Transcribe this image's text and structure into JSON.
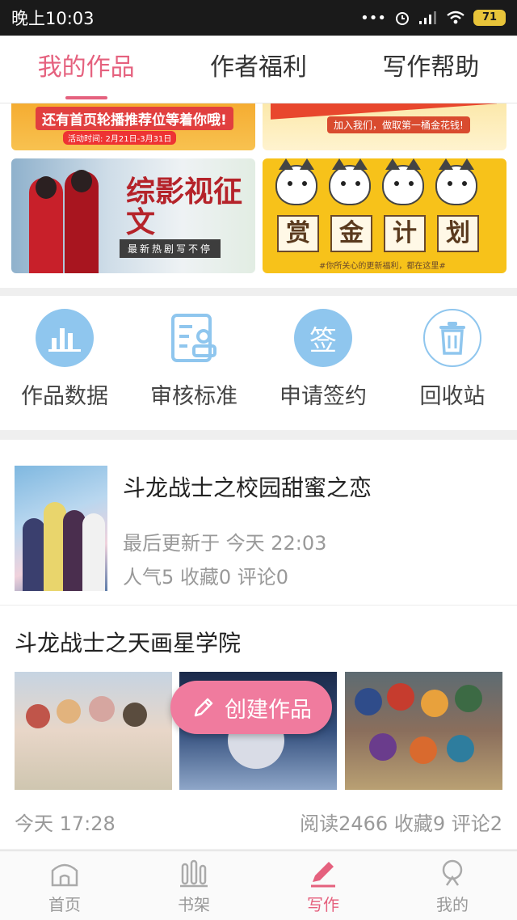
{
  "status_bar": {
    "time": "晚上10:03",
    "signal_dots": "•••",
    "battery": "71"
  },
  "top_tabs": [
    {
      "label": "我的作品",
      "active": true
    },
    {
      "label": "作者福利",
      "active": false
    },
    {
      "label": "写作帮助",
      "active": false
    }
  ],
  "banners": {
    "a": {
      "text": "还有首页轮播推荐位等着你哦!",
      "sub": "活动时间: 2月21日-3月31日"
    },
    "b": {
      "text": "加入我们，做取第一桶金花钱!"
    },
    "c": {
      "title": "综影视征文",
      "tag": "最新热剧写不停"
    },
    "d": {
      "tiles": [
        "赏",
        "金",
        "计",
        "划"
      ],
      "caption": "#你所关心的更新福利，都在这里#"
    }
  },
  "actions": [
    {
      "label": "作品数据",
      "icon": "bar-chart-icon"
    },
    {
      "label": "审核标准",
      "icon": "document-check-icon"
    },
    {
      "label": "申请签约",
      "icon": "sign-icon",
      "icon_text": "签"
    },
    {
      "label": "回收站",
      "icon": "trash-icon"
    }
  ],
  "works": [
    {
      "title": "斗龙战士之校园甜蜜之恋",
      "updated": "最后更新于 今天 22:03",
      "stats": "人气5 收藏0 评论0"
    },
    {
      "title": "斗龙战士之天画星学院",
      "time": "今天 17:28",
      "stats": "阅读2466 收藏9 评论2"
    }
  ],
  "create_button": {
    "label": "创建作品"
  },
  "bottom_nav": [
    {
      "label": "首页",
      "icon": "home-icon",
      "active": false
    },
    {
      "label": "书架",
      "icon": "bookshelf-icon",
      "active": false
    },
    {
      "label": "写作",
      "icon": "pen-icon",
      "active": true
    },
    {
      "label": "我的",
      "icon": "profile-icon",
      "active": false
    }
  ],
  "colors": {
    "accent": "#e5617e",
    "icon_blue": "#8fc6ee",
    "create_button": "#f07b9e",
    "muted_text": "#999999"
  }
}
